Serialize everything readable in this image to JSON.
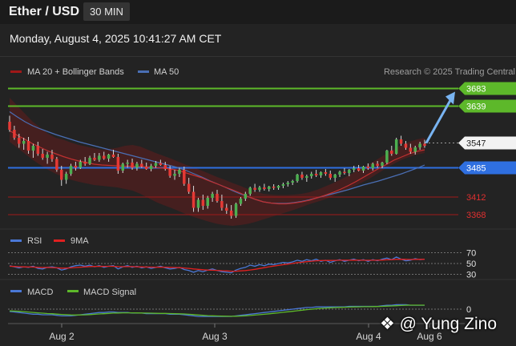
{
  "header": {
    "pair": "Ether / USD",
    "timeframe": "30 MIN",
    "datetime": "Monday, August 4, 2025 10:41:27 AM CET"
  },
  "legend": {
    "ma20": "MA 20 + Bollinger Bands",
    "ma50": "MA 50",
    "credit": "Research © 2025 Trading Central"
  },
  "rsi_panel": {
    "rsi_label": "RSI",
    "ma9_label": "9MA"
  },
  "macd_panel": {
    "macd_label": "MACD",
    "signal_label": "MACD Signal"
  },
  "watermark": "@ Yung Zino",
  "colors": {
    "bull": "#4caf50",
    "bear": "#e53935",
    "ma20": "#8b1a1a",
    "ma50": "#4a6fb5",
    "green_level": "#5db82a",
    "blue_level": "#2f6fe0",
    "red_level": "#a01818",
    "arrow": "#79b4f2",
    "price_tag": "#f2f2f2"
  },
  "chart_data": [
    {
      "type": "candlestick",
      "x_ticks": [
        "Aug 2",
        "Aug 3",
        "Aug 4",
        "Aug 6"
      ],
      "ylim": [
        3340,
        3700
      ],
      "candles": [
        [
          3600,
          3615,
          3575,
          3580
        ],
        [
          3580,
          3590,
          3555,
          3560
        ],
        [
          3560,
          3570,
          3535,
          3545
        ],
        [
          3545,
          3560,
          3530,
          3552
        ],
        [
          3552,
          3562,
          3520,
          3528
        ],
        [
          3528,
          3545,
          3510,
          3540
        ],
        [
          3540,
          3550,
          3515,
          3520
        ],
        [
          3520,
          3532,
          3505,
          3510
        ],
        [
          3510,
          3525,
          3495,
          3518
        ],
        [
          3518,
          3530,
          3500,
          3507
        ],
        [
          3507,
          3512,
          3475,
          3480
        ],
        [
          3480,
          3490,
          3440,
          3455
        ],
        [
          3455,
          3475,
          3445,
          3470
        ],
        [
          3470,
          3495,
          3465,
          3490
        ],
        [
          3490,
          3500,
          3478,
          3485
        ],
        [
          3485,
          3505,
          3482,
          3500
        ],
        [
          3500,
          3512,
          3490,
          3495
        ],
        [
          3495,
          3515,
          3492,
          3510
        ],
        [
          3510,
          3522,
          3502,
          3505
        ],
        [
          3505,
          3522,
          3500,
          3515
        ],
        [
          3515,
          3525,
          3505,
          3508
        ],
        [
          3508,
          3520,
          3500,
          3518
        ],
        [
          3518,
          3530,
          3510,
          3512
        ],
        [
          3512,
          3520,
          3470,
          3478
        ],
        [
          3478,
          3498,
          3472,
          3495
        ],
        [
          3495,
          3505,
          3485,
          3498
        ],
        [
          3498,
          3508,
          3480,
          3485
        ],
        [
          3485,
          3500,
          3478,
          3495
        ],
        [
          3495,
          3505,
          3485,
          3488
        ],
        [
          3488,
          3498,
          3480,
          3482
        ],
        [
          3482,
          3495,
          3476,
          3490
        ],
        [
          3490,
          3502,
          3485,
          3497
        ],
        [
          3497,
          3505,
          3490,
          3492
        ],
        [
          3492,
          3500,
          3478,
          3482
        ],
        [
          3482,
          3490,
          3460,
          3465
        ],
        [
          3465,
          3480,
          3455,
          3470
        ],
        [
          3470,
          3485,
          3462,
          3480
        ],
        [
          3480,
          3488,
          3440,
          3445
        ],
        [
          3445,
          3460,
          3420,
          3425
        ],
        [
          3425,
          3440,
          3375,
          3385
        ],
        [
          3385,
          3410,
          3375,
          3405
        ],
        [
          3405,
          3418,
          3380,
          3390
        ],
        [
          3390,
          3415,
          3383,
          3410
        ],
        [
          3410,
          3425,
          3400,
          3420
        ],
        [
          3420,
          3430,
          3398,
          3402
        ],
        [
          3402,
          3418,
          3378,
          3385
        ],
        [
          3385,
          3395,
          3370,
          3378
        ],
        [
          3378,
          3392,
          3358,
          3365
        ],
        [
          3365,
          3398,
          3360,
          3395
        ],
        [
          3395,
          3412,
          3390,
          3408
        ],
        [
          3408,
          3425,
          3402,
          3420
        ],
        [
          3420,
          3438,
          3415,
          3435
        ],
        [
          3435,
          3445,
          3425,
          3430
        ],
        [
          3430,
          3440,
          3425,
          3436
        ],
        [
          3436,
          3445,
          3428,
          3432
        ],
        [
          3432,
          3440,
          3426,
          3438
        ],
        [
          3438,
          3444,
          3430,
          3435
        ],
        [
          3435,
          3442,
          3430,
          3440
        ],
        [
          3440,
          3448,
          3434,
          3444
        ],
        [
          3444,
          3452,
          3438,
          3448
        ],
        [
          3448,
          3455,
          3442,
          3452
        ],
        [
          3452,
          3470,
          3448,
          3468
        ],
        [
          3468,
          3475,
          3455,
          3460
        ],
        [
          3460,
          3468,
          3450,
          3464
        ],
        [
          3464,
          3475,
          3458,
          3470
        ],
        [
          3470,
          3480,
          3462,
          3466
        ],
        [
          3466,
          3476,
          3460,
          3474
        ],
        [
          3474,
          3482,
          3465,
          3470
        ],
        [
          3470,
          3478,
          3455,
          3460
        ],
        [
          3460,
          3470,
          3450,
          3468
        ],
        [
          3468,
          3478,
          3462,
          3475
        ],
        [
          3475,
          3484,
          3468,
          3472
        ],
        [
          3472,
          3482,
          3464,
          3480
        ],
        [
          3480,
          3490,
          3474,
          3484
        ],
        [
          3484,
          3492,
          3476,
          3478
        ],
        [
          3478,
          3490,
          3472,
          3488
        ],
        [
          3488,
          3496,
          3480,
          3484
        ],
        [
          3484,
          3498,
          3478,
          3495
        ],
        [
          3495,
          3502,
          3485,
          3490
        ],
        [
          3490,
          3500,
          3484,
          3498
        ],
        [
          3498,
          3530,
          3494,
          3528
        ],
        [
          3528,
          3540,
          3515,
          3520
        ],
        [
          3520,
          3560,
          3518,
          3556
        ],
        [
          3556,
          3565,
          3540,
          3545
        ],
        [
          3545,
          3552,
          3530,
          3535
        ],
        [
          3535,
          3545,
          3520,
          3525
        ],
        [
          3525,
          3540,
          3518,
          3536
        ],
        [
          3536,
          3550,
          3530,
          3545
        ],
        [
          3545,
          3555,
          3535,
          3540
        ]
      ],
      "ma20": [
        3578,
        3566,
        3556,
        3545,
        3536,
        3527,
        3520,
        3513,
        3507,
        3502,
        3498,
        3494,
        3492,
        3491,
        3490,
        3489,
        3489,
        3488,
        3487,
        3486,
        3484,
        3482,
        3478,
        3472,
        3466,
        3460,
        3452,
        3445,
        3437,
        3430,
        3422,
        3413,
        3406,
        3400,
        3397,
        3395,
        3395,
        3397,
        3400,
        3404,
        3410,
        3416,
        3423,
        3431,
        3440,
        3450,
        3461,
        3472,
        3483,
        3493,
        3504,
        3512,
        3520,
        3526,
        3530
      ],
      "ma50": [
        3625,
        3612,
        3600,
        3590,
        3582,
        3575,
        3568,
        3562,
        3556,
        3550,
        3545,
        3540,
        3535,
        3530,
        3525,
        3520,
        3515,
        3510,
        3505,
        3500,
        3495,
        3490,
        3485,
        3478,
        3470,
        3462,
        3453,
        3445,
        3437,
        3428,
        3420,
        3413,
        3406,
        3400,
        3397,
        3396,
        3396,
        3398,
        3401,
        3405,
        3410,
        3415,
        3420,
        3425,
        3430,
        3436,
        3442,
        3447,
        3452,
        3458,
        3464,
        3470,
        3477,
        3484,
        3492
      ],
      "bands_upper": [
        3660,
        3640,
        3620,
        3600,
        3585,
        3570,
        3560,
        3555,
        3548,
        3542,
        3538,
        3534,
        3530,
        3532,
        3535,
        3540,
        3542,
        3538,
        3530,
        3522,
        3515,
        3508,
        3500,
        3492,
        3486,
        3478,
        3470,
        3462,
        3455,
        3447,
        3440,
        3432,
        3426,
        3420,
        3418,
        3417,
        3417,
        3418,
        3420,
        3424,
        3430,
        3438,
        3446,
        3455,
        3465,
        3475,
        3486,
        3497,
        3508,
        3520,
        3532,
        3542,
        3550,
        3556,
        3560
      ],
      "bands_lower": [
        3550,
        3535,
        3520,
        3505,
        3492,
        3480,
        3470,
        3462,
        3455,
        3450,
        3446,
        3442,
        3440,
        3438,
        3436,
        3432,
        3428,
        3420,
        3410,
        3400,
        3392,
        3385,
        3377,
        3369,
        3362,
        3356,
        3350,
        3345,
        3342,
        3340,
        3342,
        3345,
        3350,
        3356,
        3362,
        3368,
        3374,
        3380,
        3387,
        3394,
        3400,
        3406,
        3414,
        3422,
        3430,
        3440,
        3450,
        3460,
        3472,
        3484,
        3495,
        3505,
        3512,
        3518,
        3522
      ],
      "levels": [
        {
          "value": 3683,
          "label": "3683",
          "style": "resistance"
        },
        {
          "value": 3639,
          "label": "3639",
          "style": "resistance"
        },
        {
          "value": 3547,
          "label": "3547",
          "style": "last"
        },
        {
          "value": 3485,
          "label": "3485",
          "style": "pivot"
        },
        {
          "value": 3412,
          "label": "3412",
          "style": "support"
        },
        {
          "value": 3368,
          "label": "3368",
          "style": "support"
        }
      ]
    },
    {
      "type": "line",
      "name": "RSI",
      "ylim": [
        25,
        75
      ],
      "guides": [
        70,
        50,
        30
      ],
      "guide_labels": [
        "70",
        "50",
        "30"
      ],
      "series": [
        {
          "name": "RSI",
          "values": [
            46,
            44,
            42,
            44,
            43,
            45,
            41,
            40,
            43,
            44,
            42,
            38,
            40,
            44,
            46,
            47,
            45,
            47,
            44,
            46,
            43,
            45,
            46,
            40,
            44,
            46,
            43,
            45,
            42,
            44,
            41,
            43,
            45,
            42,
            40,
            41,
            43,
            39,
            37,
            34,
            37,
            35,
            38,
            40,
            37,
            35,
            34,
            33,
            38,
            41,
            43,
            47,
            45,
            48,
            46,
            49,
            48,
            50,
            52,
            51,
            53,
            56,
            54,
            57,
            55,
            58,
            54,
            56,
            52,
            55,
            57,
            54,
            56,
            58,
            55,
            57,
            54,
            57,
            55,
            58,
            60,
            57,
            62,
            58,
            55,
            56,
            59,
            57,
            58
          ]
        },
        {
          "name": "9MA",
          "values": [
            45,
            44.5,
            44,
            43.8,
            43.5,
            43.6,
            43,
            42.6,
            42.8,
            42.5,
            42,
            41.5,
            41.5,
            42,
            42.7,
            43.3,
            43.8,
            44.4,
            44.6,
            44.8,
            44.7,
            44.8,
            44.9,
            44.2,
            44.1,
            44.3,
            44.2,
            44,
            43.7,
            43.6,
            43.4,
            43.3,
            43.4,
            43.3,
            43,
            42.6,
            42.3,
            41.7,
            41,
            40,
            39.3,
            38.5,
            37.9,
            37.7,
            37.3,
            36.8,
            36.4,
            35.9,
            35.9,
            36.4,
            37.1,
            38.1,
            39.3,
            40.9,
            42.3,
            43.9,
            45.3,
            46.5,
            47.8,
            49,
            50.1,
            51.4,
            52.4,
            53.4,
            54.2,
            55,
            55.4,
            55.7,
            55.6,
            55.8,
            56.1,
            56,
            56.1,
            56.3,
            56.1,
            56.1,
            55.9,
            56.1,
            56.1,
            56.3,
            56.9,
            57,
            57.6,
            57.8,
            57.6,
            57.4,
            57.6,
            57.6,
            57.8
          ]
        }
      ]
    },
    {
      "type": "line",
      "name": "MACD",
      "ylim": [
        -20,
        20
      ],
      "guides": [
        0
      ],
      "guide_labels": [
        "0"
      ],
      "series": [
        {
          "name": "MACD",
          "values": [
            -4,
            -5,
            -6,
            -7,
            -8,
            -9,
            -9,
            -10,
            -10,
            -10,
            -11,
            -12,
            -12,
            -12,
            -11,
            -10,
            -9,
            -8,
            -7,
            -6,
            -6,
            -5,
            -5,
            -6,
            -6,
            -6,
            -7,
            -7,
            -7,
            -8,
            -8,
            -8,
            -8,
            -8,
            -9,
            -9,
            -9,
            -10,
            -11,
            -12,
            -13,
            -13,
            -13,
            -13,
            -13,
            -13,
            -13,
            -13,
            -12,
            -11,
            -10,
            -9,
            -8,
            -7,
            -6,
            -5,
            -4,
            -3,
            -2,
            -1,
            0,
            1,
            2,
            3,
            3,
            4,
            4,
            4,
            4,
            4,
            4,
            4,
            5,
            5,
            5,
            5,
            5,
            5,
            5,
            6,
            7,
            7,
            8,
            8,
            8,
            7,
            7,
            7,
            7
          ]
        },
        {
          "name": "MACD Signal",
          "values": [
            -3,
            -3.4,
            -3.9,
            -4.5,
            -5.2,
            -5.9,
            -6.5,
            -7.2,
            -7.8,
            -8.2,
            -8.8,
            -9.4,
            -9.9,
            -10.3,
            -10.4,
            -10.3,
            -10.1,
            -9.7,
            -9.2,
            -8.6,
            -8.1,
            -7.5,
            -7,
            -6.8,
            -6.6,
            -6.5,
            -6.6,
            -6.7,
            -6.8,
            -7,
            -7.2,
            -7.4,
            -7.5,
            -7.6,
            -7.9,
            -8.1,
            -8.3,
            -8.6,
            -9.1,
            -9.7,
            -10.4,
            -11,
            -11.5,
            -11.9,
            -12.2,
            -12.4,
            -12.6,
            -12.7,
            -12.6,
            -12.3,
            -11.8,
            -11.3,
            -10.6,
            -9.9,
            -9.1,
            -8.3,
            -7.4,
            -6.5,
            -5.6,
            -4.7,
            -3.8,
            -2.8,
            -1.9,
            -0.9,
            -0.1,
            0.7,
            1.4,
            2,
            2.5,
            2.9,
            3.2,
            3.4,
            3.7,
            4,
            4.2,
            4.4,
            4.5,
            4.6,
            4.7,
            5,
            5.4,
            5.7,
            6.2,
            6.6,
            7,
            7.1,
            7.1,
            7.1,
            7.1
          ]
        }
      ]
    }
  ]
}
